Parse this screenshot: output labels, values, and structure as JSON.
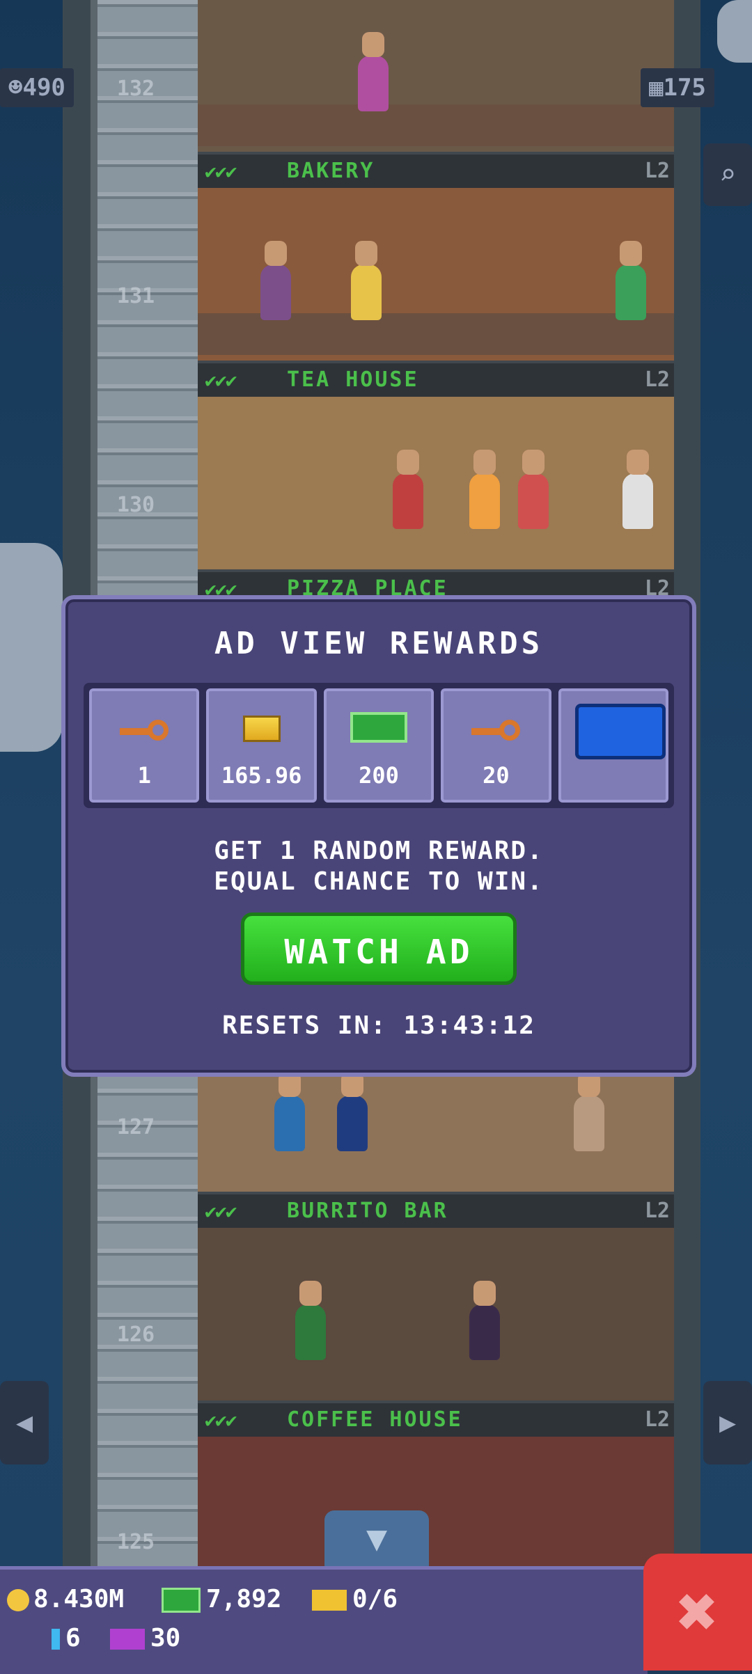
{
  "top_stats": {
    "population": "490",
    "floors": "175"
  },
  "floors": [
    {
      "number": "132",
      "name": "BAKERY",
      "level": "L2",
      "checks": "✔✔✔",
      "color": "#6b5948"
    },
    {
      "number": "131",
      "name": "TEA HOUSE",
      "level": "L2",
      "checks": "✔✔✔",
      "color": "#8a5a3c"
    },
    {
      "number": "130",
      "name": "PIZZA PLACE",
      "level": "L2",
      "checks": "✔✔✔",
      "color": "#9c7a52"
    },
    {
      "number": "127",
      "name": "BURRITO BAR",
      "level": "L2",
      "checks": "✔✔✔",
      "color": "#8f7358"
    },
    {
      "number": "126",
      "name": "COFFEE HOUSE",
      "level": "L2",
      "checks": "✔✔✔",
      "color": "#5b4a3e"
    },
    {
      "number": "125",
      "name": "",
      "level": "",
      "checks": "",
      "color": "#6b3a34"
    }
  ],
  "modal": {
    "title": "AD VIEW REWARDS",
    "rewards": [
      {
        "icon": "key-icon",
        "value": "1"
      },
      {
        "icon": "gold-bars-icon",
        "value": "165.96"
      },
      {
        "icon": "cash-icon",
        "value": "200"
      },
      {
        "icon": "key-icon",
        "value": "20"
      },
      {
        "icon": "blue-chest-icon",
        "value": ""
      }
    ],
    "description_line1": "GET 1 RANDOM REWARD.",
    "description_line2": "EQUAL CHANCE TO WIN.",
    "watch_button": "WATCH AD",
    "resets": "RESETS IN: 13:43:12"
  },
  "resources": {
    "coins": "8.430M",
    "bux": "7,892",
    "tickets": "0/6",
    "gems": "6",
    "vip": "30"
  },
  "colors": {
    "accent_green": "#2ec02a",
    "panel": "#4a4578",
    "close_red": "#e03a3a"
  }
}
